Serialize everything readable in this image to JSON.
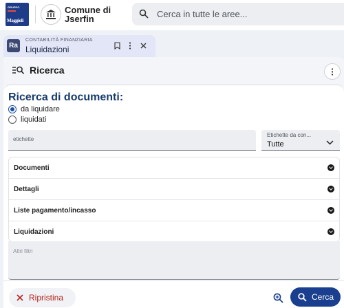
{
  "header": {
    "logo_top": "GRUPPO",
    "logo_name": "Maggioli",
    "municipality_line1": "Comune di",
    "municipality_line2": "Jserfin",
    "search_placeholder": "Cerca in tutte le aree..."
  },
  "tab": {
    "logo_text": "Ra",
    "subtitle": "CONTABILITÀ FINANZIARIA",
    "title": "Liquidazioni",
    "actions": [
      "bookmark-icon",
      "more-vert-icon",
      "close-icon"
    ]
  },
  "panel": {
    "title": "Ricerca",
    "heading": "Ricerca di documenti:",
    "radio_options": [
      {
        "label": "da liquidare",
        "checked": true
      },
      {
        "label": "liquidati",
        "checked": false
      }
    ],
    "etichette_placeholder": "etichette",
    "select": {
      "label": "Etichette da con...",
      "value": "Tutte"
    },
    "accordions": [
      {
        "label": "Documenti"
      },
      {
        "label": "Dettagli"
      },
      {
        "label": "Liste pagamento/incasso"
      },
      {
        "label": "Liquidazioni"
      }
    ],
    "altri_filtri_placeholder": "Altri filtri"
  },
  "footer": {
    "reset_label": "Ripristina",
    "search_label": "Cerca"
  },
  "colors": {
    "brand_blue": "#1a3f8f",
    "heading_blue": "#173b6c",
    "reset_red": "#b3261e"
  }
}
